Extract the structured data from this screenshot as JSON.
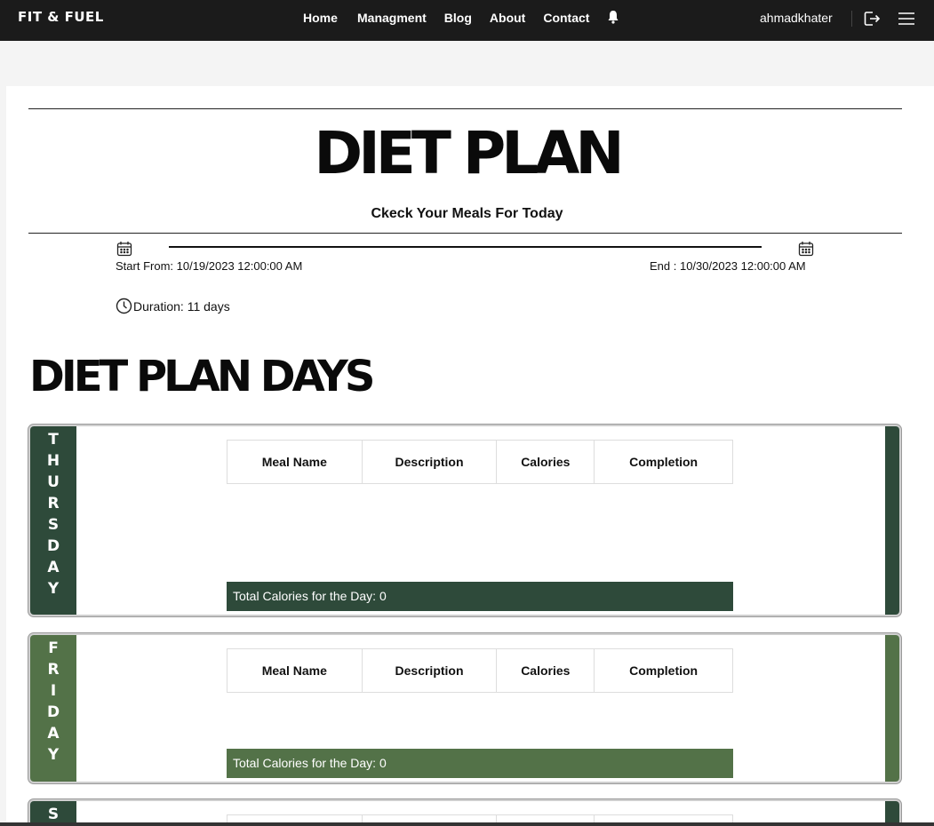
{
  "navbar": {
    "brand": "FIT & FUEL",
    "links": [
      "Home",
      "Managment",
      "Blog",
      "About",
      "Contact"
    ],
    "user": "ahmadkhater"
  },
  "header": {
    "title": "DIET PLAN",
    "subtitle": "Ckeck Your Meals For Today"
  },
  "plan": {
    "start": "Start From: 10/19/2023 12:00:00 AM",
    "end": "End : 10/30/2023 12:00:00 AM",
    "duration": "Duration: 11 days"
  },
  "days_title": "DIET PLAN DAYS",
  "table_headers": [
    "Meal Name",
    "Description",
    "Calories",
    "Completion"
  ],
  "days": [
    {
      "name": "THURSDAY",
      "color": "#2e4a3a",
      "total": "Total Calories for the Day: 0"
    },
    {
      "name": "FRIDAY",
      "color": "#537248",
      "total": "Total Calories for the Day: 0"
    },
    {
      "name": "S",
      "color": "#2e4a3a"
    }
  ],
  "icons": [
    "bell-icon",
    "logout-icon",
    "menu-icon",
    "calendar-icon",
    "clock-icon"
  ]
}
